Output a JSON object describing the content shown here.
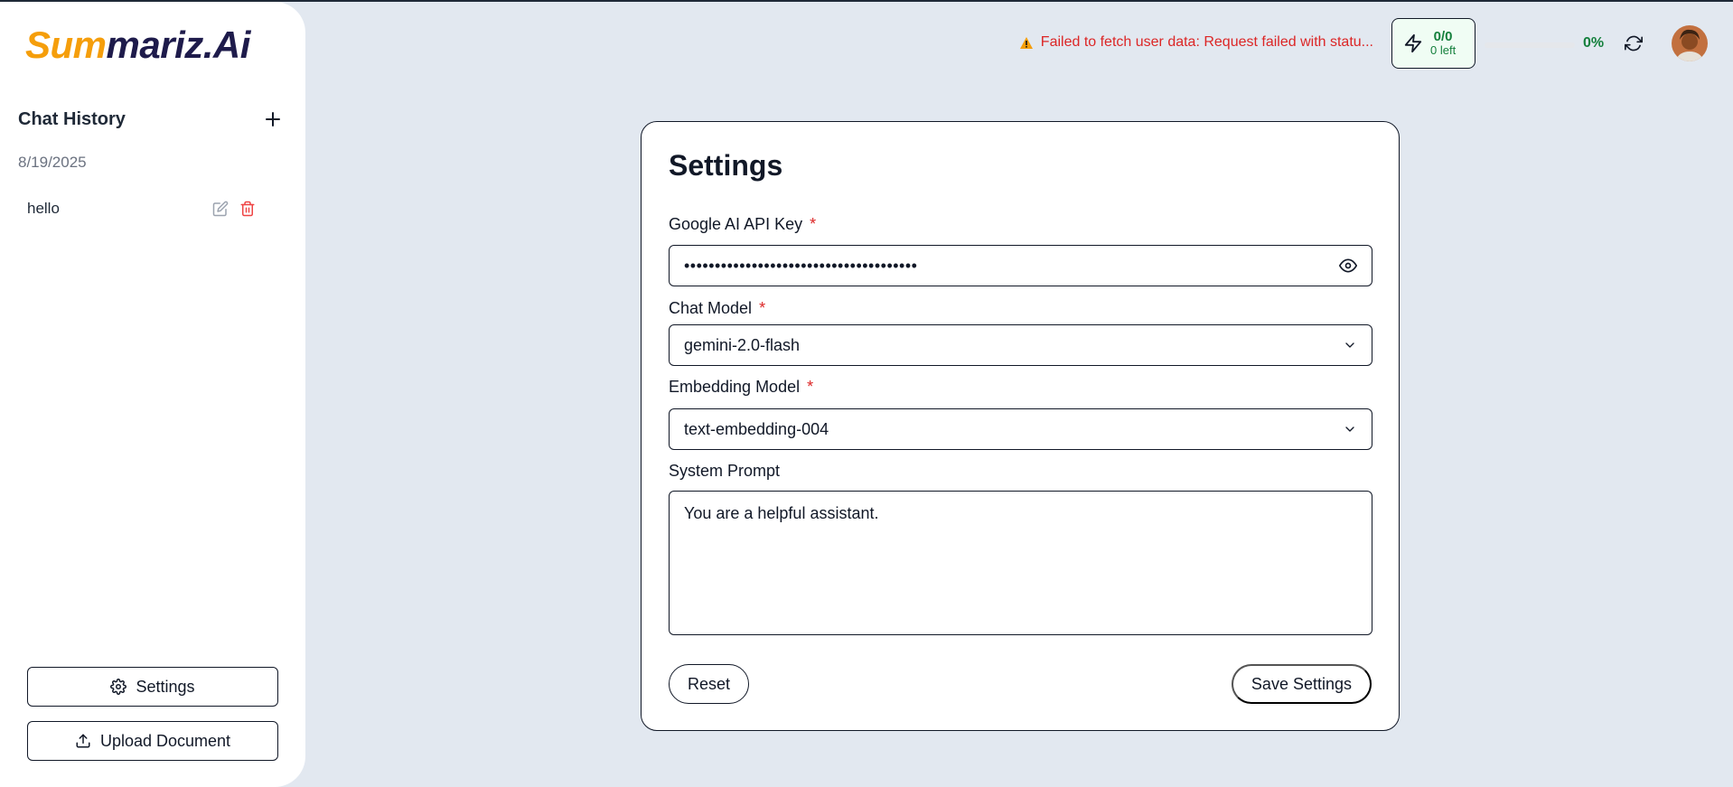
{
  "brand": {
    "part1": "Sum",
    "part2": "mariz.Ai",
    "accent_color": "#f59e0b",
    "dark_color": "#1e1b4b"
  },
  "sidebar": {
    "history_title": "Chat History",
    "new_chat_icon": "plus-icon",
    "date_group": "8/19/2025",
    "chats": [
      {
        "label": "hello",
        "edit_icon": "edit-icon",
        "delete_icon": "trash-icon"
      }
    ],
    "settings_button": "Settings",
    "upload_button": "Upload Document"
  },
  "topbar": {
    "error_text": "Failed to fetch user data: Request failed with statu...",
    "error_icon": "warning-icon",
    "credits_count": "0/0",
    "credits_left": "0 left",
    "credits_icon": "lightning-icon",
    "progress_percent": "0%",
    "progress_value": 0,
    "refresh_icon": "refresh-icon",
    "avatar_icon": "user-avatar"
  },
  "settings": {
    "title": "Settings",
    "api_key_label": "Google AI API Key",
    "api_key_value": "••••••••••••••••••••••••••••••••••••••",
    "chat_model_label": "Chat Model",
    "chat_model_value": "gemini-2.0-flash",
    "embedding_model_label": "Embedding Model",
    "embedding_model_value": "text-embedding-004",
    "system_prompt_label": "System Prompt",
    "system_prompt_value": "You are a helpful assistant.",
    "required_marker": "*",
    "reset_button": "Reset",
    "save_button": "Save Settings"
  },
  "colors": {
    "background": "#e2e8f0",
    "error": "#dc2626",
    "success": "#15803d",
    "required": "#dc2626"
  }
}
